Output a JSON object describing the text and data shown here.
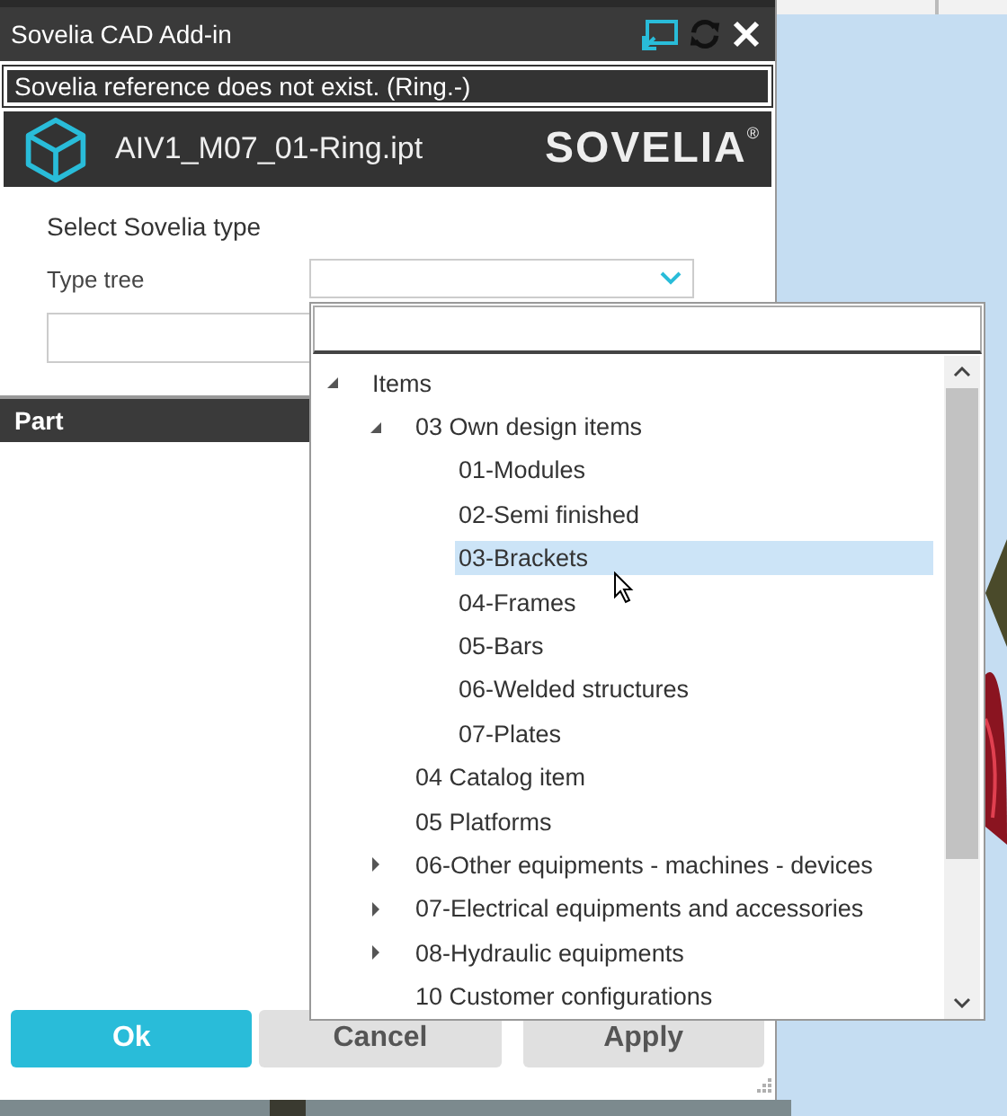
{
  "window": {
    "title": "Sovelia CAD Add-in"
  },
  "message": "Sovelia reference does not exist. (Ring.-)",
  "file": {
    "name": "AIV1_M07_01-Ring.ipt",
    "logo": "SOVELIA",
    "logo_mark": "®"
  },
  "form": {
    "heading": "Select Sovelia type",
    "type_tree_label": "Type tree"
  },
  "section": "Part",
  "tree": [
    {
      "label": "Items",
      "expanded": true,
      "children": [
        {
          "label": "03 Own design items",
          "expanded": true,
          "children": [
            {
              "label": "01-Modules",
              "selected": false
            },
            {
              "label": "02-Semi finished",
              "selected": false
            },
            {
              "label": "03-Brackets",
              "selected": true
            },
            {
              "label": "04-Frames",
              "selected": false
            },
            {
              "label": "05-Bars",
              "selected": false
            },
            {
              "label": "06-Welded structures",
              "selected": false
            },
            {
              "label": "07-Plates",
              "selected": false
            }
          ]
        },
        {
          "label": "04 Catalog item",
          "selected": false
        },
        {
          "label": "05 Platforms",
          "selected": false
        },
        {
          "label": "06-Other equipments - machines - devices",
          "expanded": false,
          "selected": false
        },
        {
          "label": "07-Electrical equipments and accessories",
          "expanded": false,
          "selected": false
        },
        {
          "label": "08-Hydraulic equipments",
          "expanded": false,
          "selected": false
        },
        {
          "label": "10 Customer configurations",
          "selected": false
        }
      ]
    }
  ],
  "buttons": [
    {
      "label": "Ok",
      "kind": "primary"
    },
    {
      "label": "Cancel",
      "kind": "secondary"
    },
    {
      "label": "Apply",
      "kind": "secondary"
    }
  ]
}
